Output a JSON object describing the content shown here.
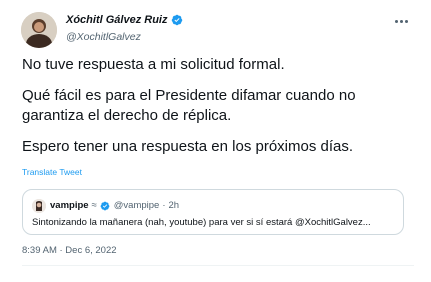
{
  "author": {
    "display_name": "Xóchitl Gálvez Ruiz",
    "handle": "@XochitlGalvez"
  },
  "tweet": {
    "paragraphs": [
      "No tuve respuesta a mi solicitud formal.",
      "Qué fácil es para el Presidente difamar cuando no garantiza el derecho de réplica.",
      "Espero tener una respuesta en los próximos días."
    ],
    "translate_label": "Translate Tweet",
    "timestamp": "8:39 AM · Dec 6, 2022"
  },
  "quote": {
    "display_name": "vampipe",
    "name_suffix": "≈",
    "handle": "@vampipe",
    "separator": "·",
    "time": "2h",
    "text": "Sintonizando la mañanera (nah, youtube) para ver si sí estará @XochitlGalvez..."
  },
  "colors": {
    "verified": "#1d9bf0",
    "link": "#1d9bf0",
    "secondary_text": "#536471"
  },
  "icons": {
    "verified": "verified-badge-icon",
    "more": "more-options-icon"
  }
}
